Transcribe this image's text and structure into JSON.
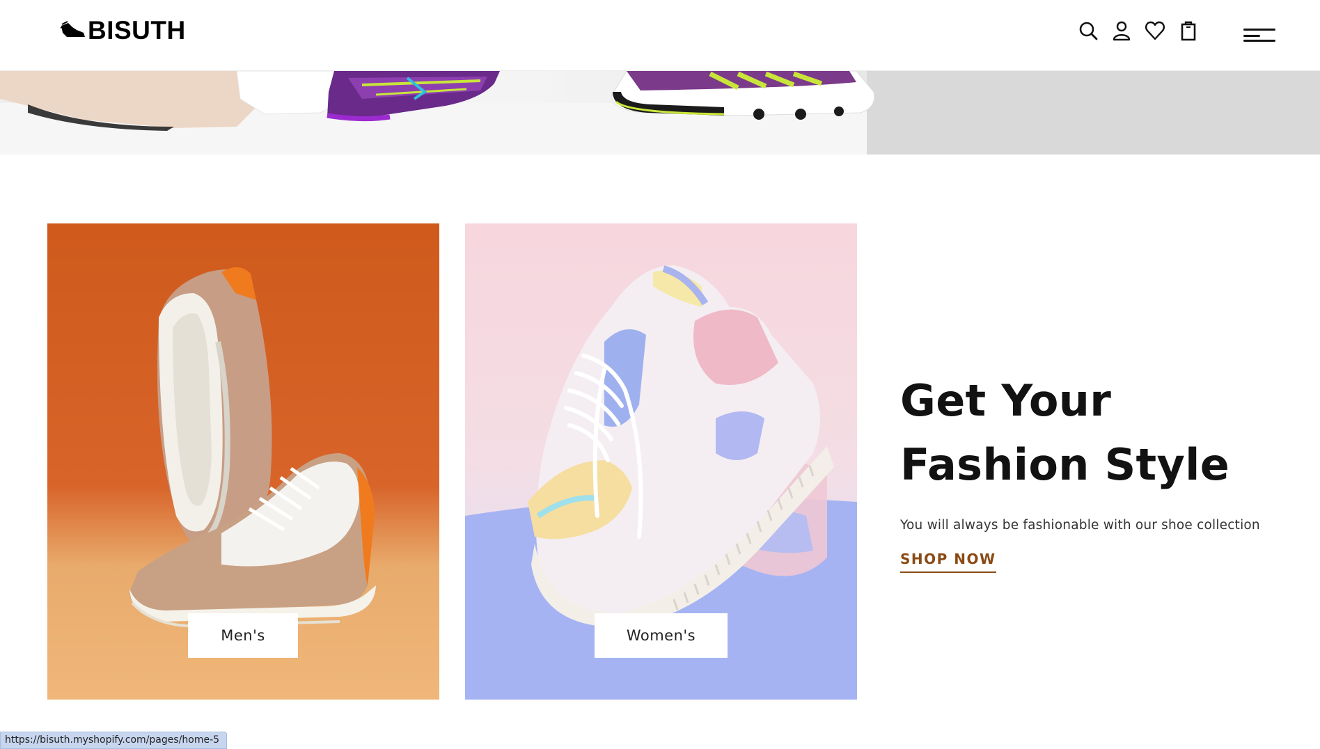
{
  "header": {
    "brand": "BISUTH",
    "icons": [
      "search-icon",
      "account-icon",
      "wishlist-icon",
      "cart-icon",
      "menu-icon"
    ]
  },
  "categories": [
    {
      "label": "Men's",
      "background": "#d35d20"
    },
    {
      "label": "Women's",
      "background": "#f6d9e1"
    }
  ],
  "promo": {
    "title_line1": "Get Your",
    "title_line2": "Fashion Style",
    "subtitle": "You will always be fashionable with our shoe collection",
    "cta_label": "SHOP NOW",
    "cta_color": "#8a4a14"
  },
  "status_bar": {
    "url": "https://bisuth.myshopify.com/pages/home-5"
  }
}
